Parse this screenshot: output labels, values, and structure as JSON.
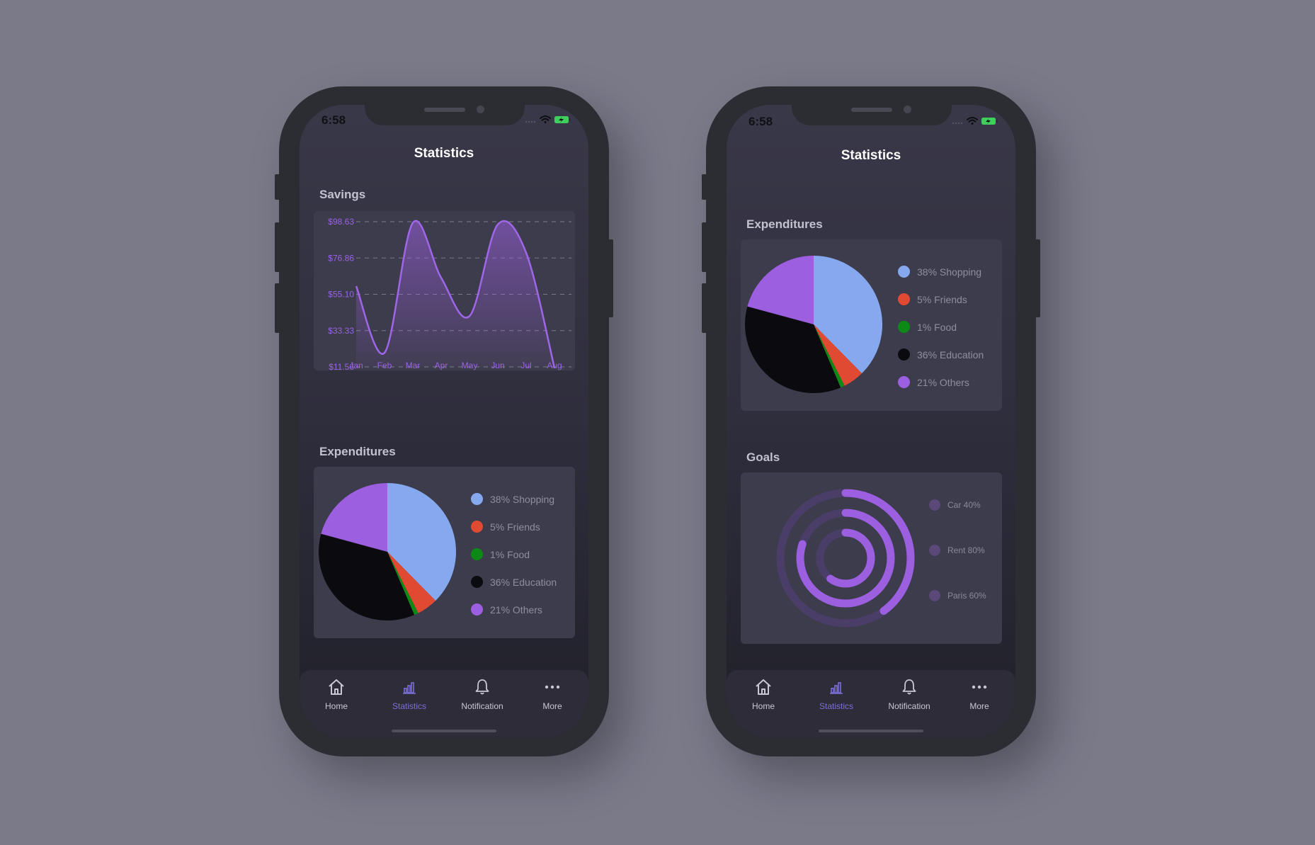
{
  "phones": [
    {
      "status_time": "6:58",
      "title": "Statistics",
      "savings": {
        "label": "Savings"
      },
      "expenditures": {
        "label": "Expenditures",
        "legend": [
          "38% Shopping",
          "5% Friends",
          "1% Food",
          "36% Education",
          "21% Others"
        ]
      },
      "tabs": [
        {
          "label": "Home",
          "icon": "home-icon"
        },
        {
          "label": "Statistics",
          "icon": "bar-chart-icon"
        },
        {
          "label": "Notification",
          "icon": "bell-icon"
        },
        {
          "label": "More",
          "icon": "more-dots-icon"
        }
      ],
      "active_tab": "Statistics"
    },
    {
      "status_time": "6:58",
      "title": "Statistics",
      "expenditures": {
        "label": "Expenditures",
        "legend": [
          "38% Shopping",
          "5% Friends",
          "1% Food",
          "36% Education",
          "21% Others"
        ]
      },
      "goals": {
        "label": "Goals",
        "items": [
          "Car 40%",
          "Rent 80%",
          "Paris 60%"
        ]
      },
      "tabs": [
        {
          "label": "Home",
          "icon": "home-icon"
        },
        {
          "label": "Statistics",
          "icon": "bar-chart-icon"
        },
        {
          "label": "Notification",
          "icon": "bell-icon"
        },
        {
          "label": "More",
          "icon": "more-dots-icon"
        }
      ],
      "active_tab": "Statistics"
    }
  ],
  "colors": {
    "accent": "#9b5fe0",
    "active_tab": "#7c6fd8",
    "shopping": "#86a8ee",
    "friends": "#e04a33",
    "food": "#0d8a16",
    "education": "#0b0b0f",
    "others": "#9b5fe0",
    "goal_ring": "#9b5fe0",
    "goal_track": "#4a3d68"
  },
  "chart_data": [
    {
      "type": "area",
      "categories": [
        "Jan",
        "Feb",
        "Mar",
        "Apr",
        "May",
        "Jun",
        "Jul",
        "Aug"
      ],
      "values": [
        60,
        20,
        98,
        65,
        42,
        97,
        80,
        11
      ],
      "y_ticks": [
        "$98.63",
        "$76.86",
        "$55.10",
        "$33.33",
        "$11.56"
      ],
      "ylim": [
        11.56,
        98.63
      ],
      "grid": true,
      "title": ""
    },
    {
      "type": "pie",
      "labels": [
        "Shopping",
        "Friends",
        "Food",
        "Education",
        "Others"
      ],
      "values": [
        38,
        5,
        1,
        36,
        21
      ],
      "legend_position": "right"
    },
    {
      "type": "pie",
      "labels": [
        "Shopping",
        "Friends",
        "Food",
        "Education",
        "Others"
      ],
      "values": [
        38,
        5,
        1,
        36,
        21
      ],
      "legend_position": "right"
    },
    {
      "type": "radial-progress",
      "labels": [
        "Car",
        "Rent",
        "Paris"
      ],
      "values": [
        40,
        80,
        60
      ],
      "unit": "%"
    }
  ]
}
